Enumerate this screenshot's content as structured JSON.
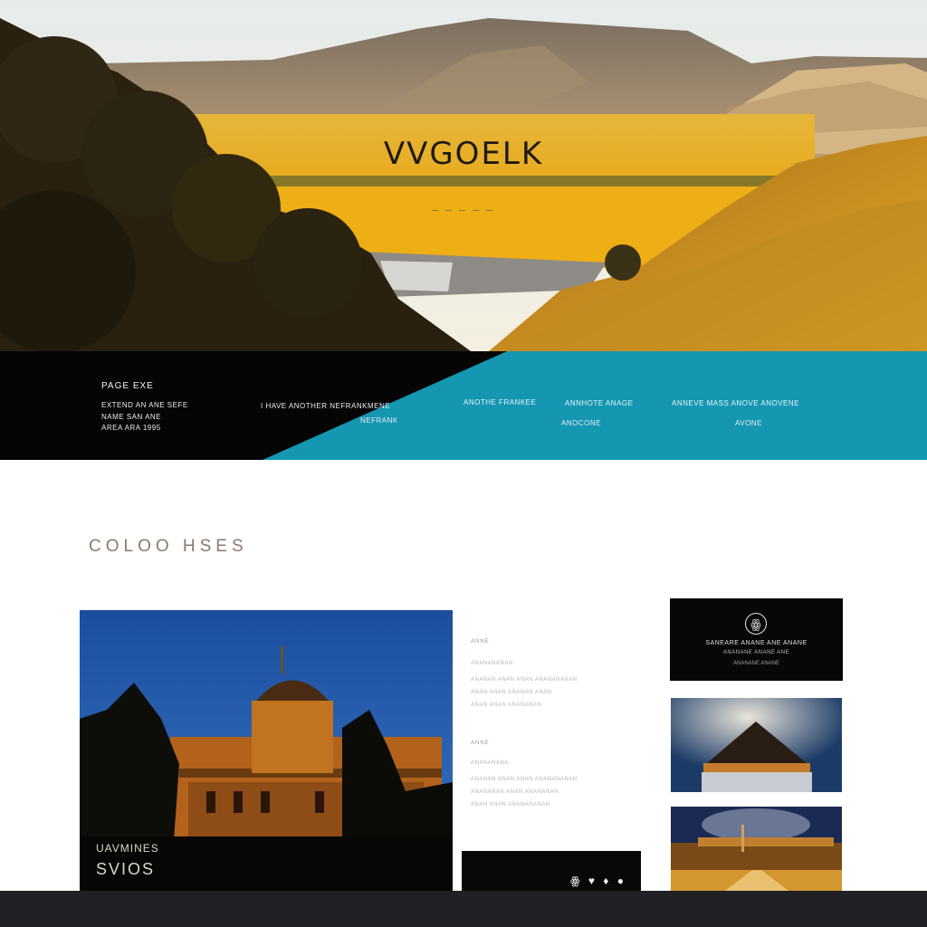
{
  "hero": {
    "title": "VVGOELK",
    "subtitle": "— — — — —"
  },
  "band": {
    "heading": "PAGE EXE",
    "info_lines": [
      "EXTEND AN ANE SEFE",
      "NAME SAN ANE",
      "AREA ARA 1995"
    ],
    "mid_text": "I HAVE ANOTHER NEFRANKMENE",
    "mid_sub": "NEFRANK",
    "nav_items": [
      "ANOTHE FRANKEE",
      "ANNHOTE ANAGE",
      "ANNEVE MASS ANOVE ANOVENE"
    ],
    "nav_sub": [
      "ANOCONE",
      "AVONE"
    ],
    "colors": {
      "dark": "#050505",
      "accent": "#1596b1"
    }
  },
  "section": {
    "title": "COLOO HSES"
  },
  "photo": {
    "caption_small": "UAVMINES",
    "caption_large": "SVIOS"
  },
  "textcol": {
    "label1": "ANNE",
    "heading1": "ANANANANAN",
    "para1": [
      "ANANAN ANAN ANAN ANANANANAN",
      "ANAN ANAN ANANAN ANAN",
      "ANAN ANAN ANANANAN"
    ],
    "label2": "ANNE",
    "heading2": "ANANANANA",
    "para2": [
      "ANANAN ANAN ANAN ANANANANAN",
      "ANANANAN ANAN ANANANAN",
      "ANAN ANAN ANANANANAN"
    ]
  },
  "blackbar": {
    "icons": "ꙮ ♥ ♦ ●"
  },
  "card_dark": {
    "logo_icon": "ꙮ",
    "line1": "SANEARE ANANE ANE ANANE",
    "line2": "ANANANE ANANE ANE",
    "line3": "ANANANE ANANE"
  }
}
